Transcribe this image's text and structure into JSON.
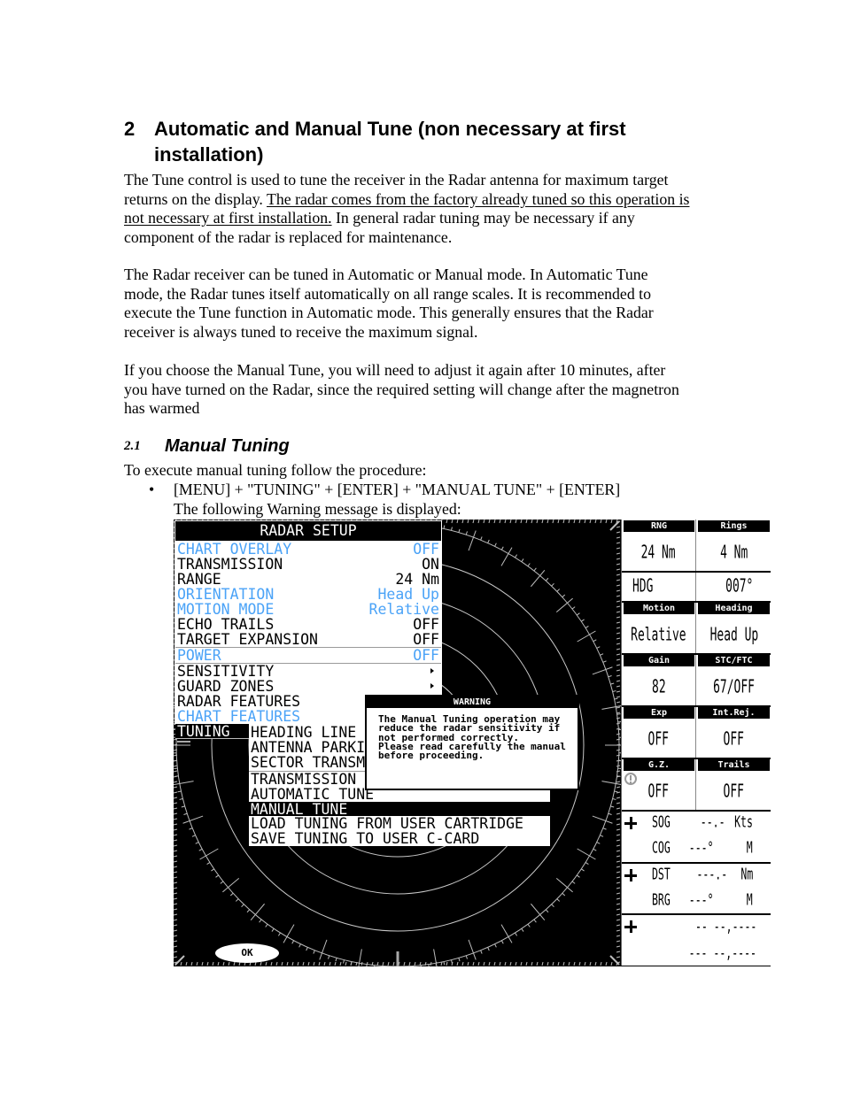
{
  "document": {
    "heading": {
      "number": "2",
      "line1": "Automatic and Manual Tune (non necessary at first",
      "line2": "installation)"
    },
    "para1": {
      "l1": "The Tune control is used to tune the receiver in the Radar antenna for maximum target",
      "l2a": "returns on the display. ",
      "l2b": "The radar comes from the factory already tuned so this operation is",
      "l3a": "not necessary at first installation.",
      "l3b": " In general radar tuning may be necessary if any",
      "l4": "component of the radar is replaced for maintenance."
    },
    "para2": [
      "The Radar receiver can be tuned in Automatic or Manual mode. In Automatic Tune",
      "mode, the Radar tunes itself automatically on all range scales. It is recommended to",
      "execute the Tune function in Automatic mode. This generally ensures that the Radar",
      "receiver is always tuned to receive the maximum signal."
    ],
    "para3": [
      "If you choose the Manual Tune, you will need to adjust it again after 10 minutes, after",
      "you have turned on the Radar, since the required setting will change after the magnetron",
      "has warmed"
    ],
    "subheading": {
      "number": "2.1",
      "title": "Manual Tuning"
    },
    "intro": "To execute manual tuning follow the procedure:",
    "bullet": "•",
    "step": "[MENU] + \"TUNING\" + [ENTER] + \"MANUAL TUNE\" + [ENTER]",
    "step_note": "The following Warning message is displayed:"
  },
  "radar": {
    "menu": {
      "title": "RADAR SETUP",
      "items": [
        {
          "label": "CHART OVERLAY",
          "value": "OFF"
        },
        {
          "label": "TRANSMISSION",
          "value": "ON"
        },
        {
          "label": "RANGE",
          "value": "24 Nm"
        },
        {
          "label": "ORIENTATION",
          "value": "Head Up"
        },
        {
          "label": "MOTION MODE",
          "value": "Relative"
        },
        {
          "label": "ECHO TRAILS",
          "value": "OFF"
        },
        {
          "label": "TARGET EXPANSION",
          "value": "OFF"
        },
        {
          "label": "POWER",
          "value": "OFF"
        },
        {
          "label": "SENSITIVITY"
        },
        {
          "label": "GUARD ZONES"
        },
        {
          "label": "RADAR FEATURES"
        },
        {
          "label": "CHART FEATURES"
        },
        {
          "label": "TUNING"
        }
      ]
    },
    "submenu": {
      "items": [
        "HEADING LINE",
        "ANTENNA PARKI",
        "SECTOR TRANSM",
        "TRANSMISSION",
        "AUTOMATIC TUNE",
        "MANUAL TUNE",
        "LOAD TUNING FROM USER CARTRIDGE",
        "SAVE TUNING TO USER C-CARD"
      ],
      "selected": "MANUAL TUNE"
    },
    "warning": {
      "title": "WARNING",
      "lines": [
        "The Manual Tuning operation may",
        "reduce the radar sensitivity if",
        "not performed correctly.",
        "Please read carefully the manual",
        "before proceeding."
      ]
    },
    "ok_button": "OK",
    "status": {
      "rng": {
        "label": "RNG",
        "value": "24 Nm"
      },
      "rings": {
        "label": "Rings",
        "value": "4 Nm"
      },
      "hdg": {
        "label": "HDG",
        "value": "007°"
      },
      "motion": {
        "label": "Motion",
        "value": "Relative"
      },
      "heading": {
        "label": "Heading",
        "value": "Head Up"
      },
      "gain": {
        "label": "Gain",
        "value": "82"
      },
      "stc_ftc": {
        "label": "STC/FTC",
        "value": "67/OFF"
      },
      "exp": {
        "label": "Exp",
        "value": "OFF"
      },
      "int_rej": {
        "label": "Int.Rej.",
        "value": "OFF"
      },
      "gz": {
        "label": "G.Z.",
        "value": "OFF",
        "icon": "alert-circle-icon"
      },
      "trails": {
        "label": "Trails",
        "value": "OFF"
      },
      "sog": {
        "label": "SOG",
        "value": "--.-",
        "unit": "Kts"
      },
      "cog": {
        "label": "COG",
        "value": "---°",
        "unit": "M"
      },
      "dst": {
        "label": "DST",
        "value": "---.-",
        "unit": "Nm"
      },
      "brg": {
        "label": "BRG",
        "value": "---°",
        "unit": "M"
      },
      "position": {
        "lat": "-- --,----",
        "lon": "--- --,----"
      }
    }
  },
  "colors": {
    "menu_inactive": "#4ba3f7",
    "screen_background": "#000000",
    "ring": "#c8c8c8"
  }
}
